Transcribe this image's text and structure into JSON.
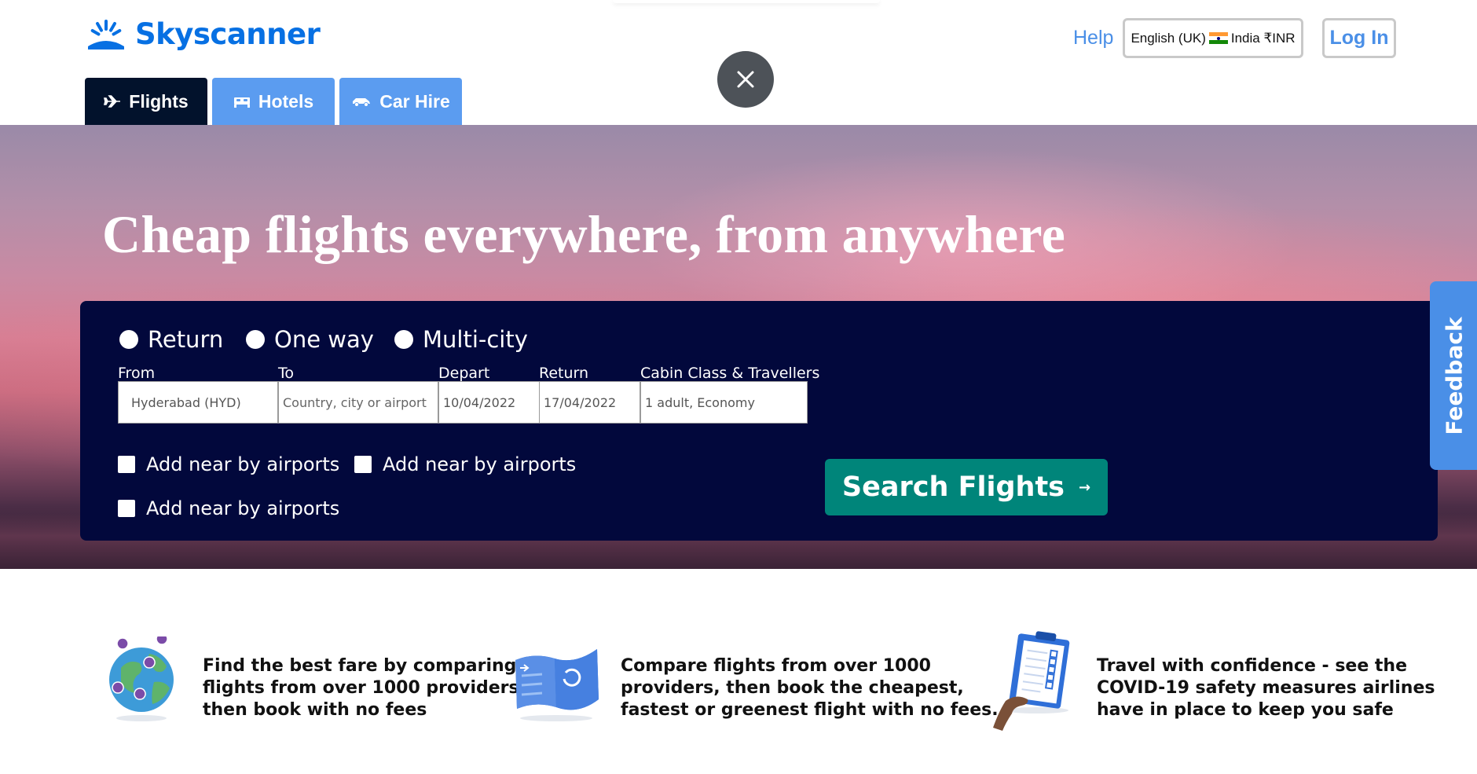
{
  "brand": {
    "name": "Skyscanner",
    "color": "#0770e3"
  },
  "header": {
    "help": "Help",
    "locale_language": "English (UK)",
    "locale_region": "India ₹INR",
    "login": "Log In"
  },
  "tabs": [
    {
      "label": "Flights",
      "icon": "plane-icon",
      "active": true
    },
    {
      "label": "Hotels",
      "icon": "bed-icon",
      "active": false
    },
    {
      "label": "Car Hire",
      "icon": "car-icon",
      "active": false
    }
  ],
  "hero": {
    "title": "Cheap flights everywhere, from anywhere"
  },
  "search": {
    "trip_types": [
      "Return",
      "One way",
      "Multi-city"
    ],
    "fields": {
      "from": {
        "label": "From",
        "value": "Hyderabad (HYD)"
      },
      "to": {
        "label": "To",
        "placeholder": "Country, city or airport"
      },
      "depart": {
        "label": "Depart",
        "value": "10/04/2022"
      },
      "return": {
        "label": "Return",
        "value": "17/04/2022"
      },
      "cabin": {
        "label": "Cabin Class & Travellers",
        "value": "1 adult, Economy"
      }
    },
    "checkbox_label": "Add near by airports",
    "button": "Search Flights",
    "button_color": "#00857a",
    "panel_color": "#02083c"
  },
  "feedback": "Feedback",
  "features": [
    {
      "icon": "globe-pins-icon",
      "lines": [
        "Find the best fare by comparing",
        "flights from over 1000 providers,",
        "then book with no fees"
      ]
    },
    {
      "icon": "map-plane-icon",
      "lines": [
        "Compare flights from over 1000",
        "providers, then book the cheapest,",
        "fastest or greenest flight with no fees."
      ]
    },
    {
      "icon": "clipboard-checklist-icon",
      "lines": [
        "Travel with confidence - see the",
        "COVID-19 safety measures airlines",
        "have in place to keep you safe"
      ]
    }
  ]
}
